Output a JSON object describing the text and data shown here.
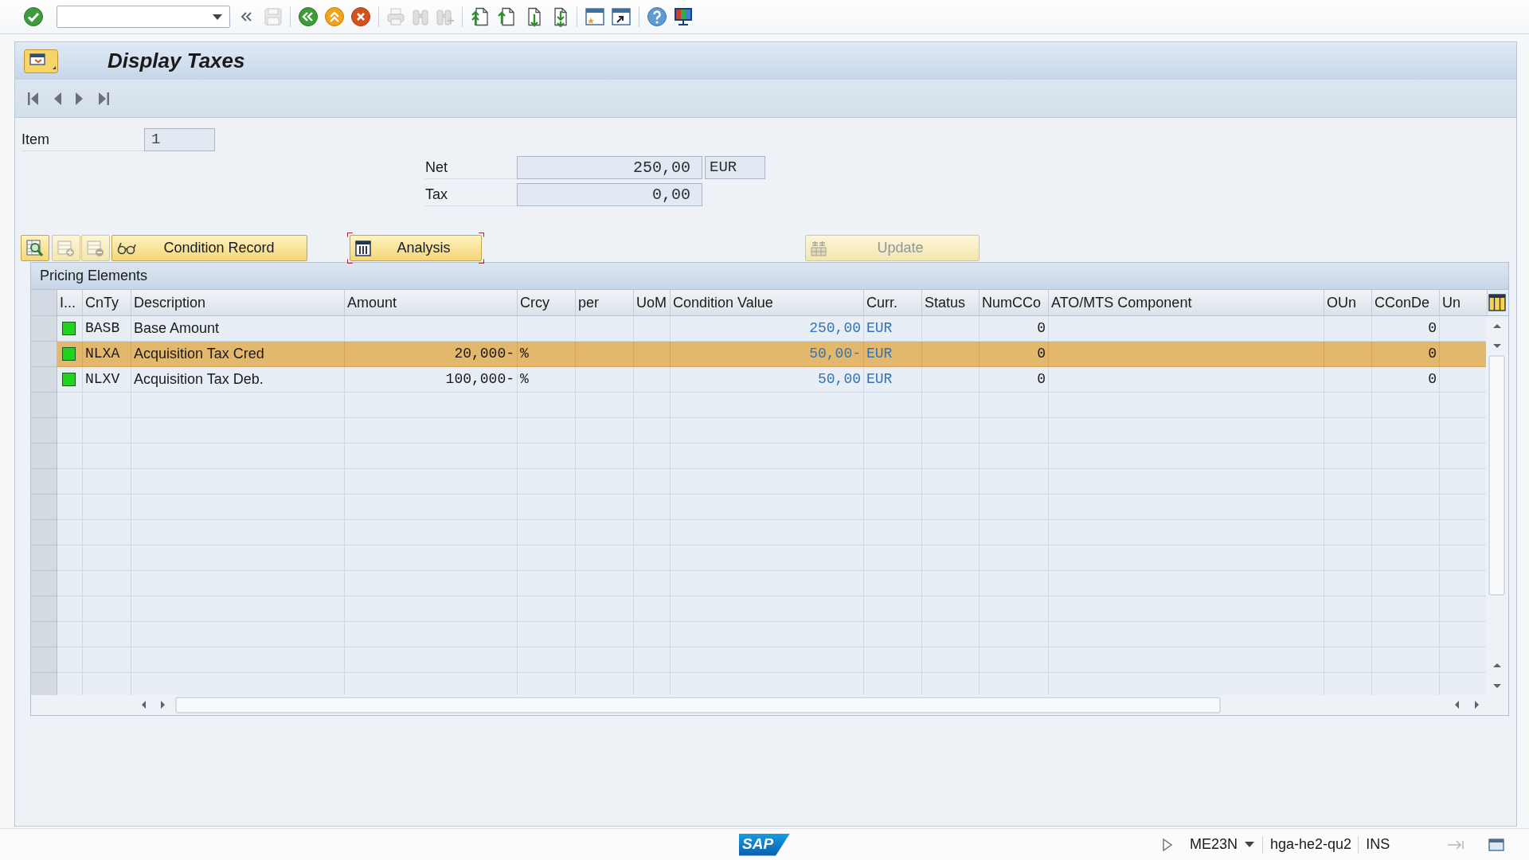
{
  "toolbar": [
    [
      {
        "kind": "enter",
        "disabled": false
      },
      {
        "kind": "command-field",
        "disabled": false
      },
      {
        "kind": "collapse",
        "disabled": false
      },
      {
        "kind": "save",
        "disabled": true
      }
    ],
    [
      {
        "kind": "back",
        "disabled": false
      },
      {
        "kind": "exit",
        "disabled": false
      },
      {
        "kind": "cancel",
        "disabled": false
      }
    ],
    [
      {
        "kind": "print",
        "disabled": true
      },
      {
        "kind": "find",
        "disabled": true
      },
      {
        "kind": "find-next",
        "disabled": true
      }
    ],
    [
      {
        "kind": "first-page",
        "disabled": false
      },
      {
        "kind": "previous-page",
        "disabled": false
      },
      {
        "kind": "next-page",
        "disabled": false
      },
      {
        "kind": "last-page",
        "disabled": false
      }
    ],
    [
      {
        "kind": "new-session",
        "disabled": false
      },
      {
        "kind": "shortcut",
        "disabled": false
      }
    ],
    [
      {
        "kind": "help",
        "disabled": false
      },
      {
        "kind": "customize",
        "disabled": false
      }
    ]
  ],
  "screen_title": "Display Taxes",
  "navigation": [
    {
      "kind": "first",
      "disabled": false
    },
    {
      "kind": "previous",
      "disabled": false
    },
    {
      "kind": "next",
      "disabled": false
    },
    {
      "kind": "last",
      "disabled": false
    }
  ],
  "item": {
    "label": "Item",
    "value": "1"
  },
  "amounts": [
    {
      "label": "Net",
      "value": "250,00",
      "currency": "EUR"
    },
    {
      "label": "Tax",
      "value": "0,00"
    }
  ],
  "buttons": [
    {
      "kind": "details",
      "disabled": false,
      "focused": false
    },
    {
      "kind": "insert-row",
      "disabled": true,
      "focused": false
    },
    {
      "kind": "delete-row",
      "disabled": true,
      "focused": false
    },
    {
      "kind": "condition-record",
      "label": "Condition Record",
      "disabled": false,
      "focused": false
    },
    {
      "kind": "analysis",
      "label": "Analysis",
      "disabled": false,
      "focused": true
    },
    {
      "kind": "update",
      "label": "Update",
      "disabled": true,
      "focused": false
    }
  ],
  "table": {
    "title": "Pricing Elements",
    "columns": [
      {
        "label": "I..."
      },
      {
        "label": "CnTy"
      },
      {
        "label": "Description"
      },
      {
        "label": "Amount"
      },
      {
        "label": "Crcy"
      },
      {
        "label": "per"
      },
      {
        "label": "UoM"
      },
      {
        "label": "Condition Value"
      },
      {
        "label": "Curr."
      },
      {
        "label": "Status"
      },
      {
        "label": "NumCCo"
      },
      {
        "label": "ATO/MTS Component"
      },
      {
        "label": "OUn"
      },
      {
        "label": "CConDe"
      },
      {
        "label": "Un"
      }
    ],
    "rows": [
      {
        "selected": false,
        "cnty": "BASB",
        "description": "Base Amount",
        "condition_value": "250,00",
        "curr": "EUR",
        "numcco": "0",
        "cconde": "0"
      },
      {
        "selected": true,
        "cnty": "NLXA",
        "description": "Acquisition Tax Cred",
        "amount": "20,000-",
        "crcy": "%",
        "condition_value": "50,00-",
        "curr": "EUR",
        "numcco": "0",
        "cconde": "0"
      },
      {
        "selected": false,
        "cnty": "NLXV",
        "description": "Acquisition Tax Deb.",
        "amount": "100,000-",
        "crcy": "%",
        "condition_value": "50,00",
        "curr": "EUR",
        "numcco": "0",
        "cconde": "0"
      }
    ]
  },
  "status_bar": {
    "logo": "SAP",
    "transaction": "ME23N",
    "server": "hga-he2-qu2",
    "mode": "INS"
  }
}
